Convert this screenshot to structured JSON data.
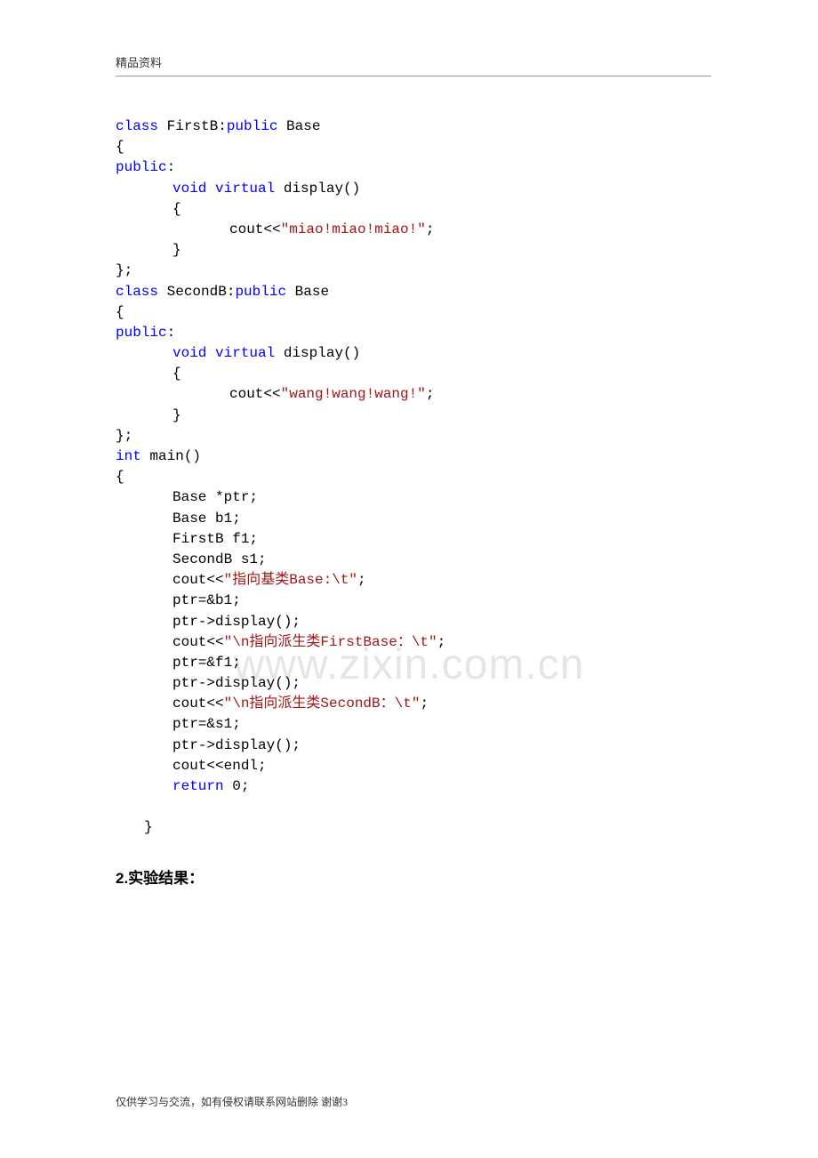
{
  "header": "精品资料",
  "watermark": "www.zixin.com.cn",
  "code": {
    "first_decl": {
      "cls": "class",
      "name": " FirstB:",
      "pub": "public",
      "base": " Base"
    },
    "second_decl": {
      "cls": "class",
      "name": " SecondB:",
      "pub": "public",
      "base": " Base"
    },
    "brace_open": "{",
    "brace_close": "}",
    "class_close": "};",
    "public": "public",
    "colon": ":",
    "vv": {
      "v1": "void",
      "sp": " ",
      "v2": "virtual",
      "sig": " display()"
    },
    "cout_pre": "cout<<",
    "semi": ";",
    "miao": "\"miao!miao!miao!\"",
    "wang": "\"wang!wang!wang!\"",
    "int": "int",
    "main_sig": " main()",
    "stmt1": "Base *ptr;",
    "stmt2": "Base b1;",
    "stmt3": "FirstB f1;",
    "stmt4": "SecondB s1;",
    "s_base": "\"指向基类Base:\\t\"",
    "ptr_b1": "ptr=&b1;",
    "ptr_disp": "ptr->display();",
    "s_first": "\"\\n指向派生类FirstBase：\\t\"",
    "ptr_f1": "ptr=&f1;",
    "s_second": "\"\\n指向派生类SecondB：\\t\"",
    "ptr_s1": "ptr=&s1;",
    "endl": "cout<<endl;",
    "return": "return",
    "zero": " 0;"
  },
  "heading": "2.实验结果：",
  "footer": {
    "text": "仅供学习与交流，如有侵权请联系网站删除 谢谢",
    "page": "3"
  }
}
